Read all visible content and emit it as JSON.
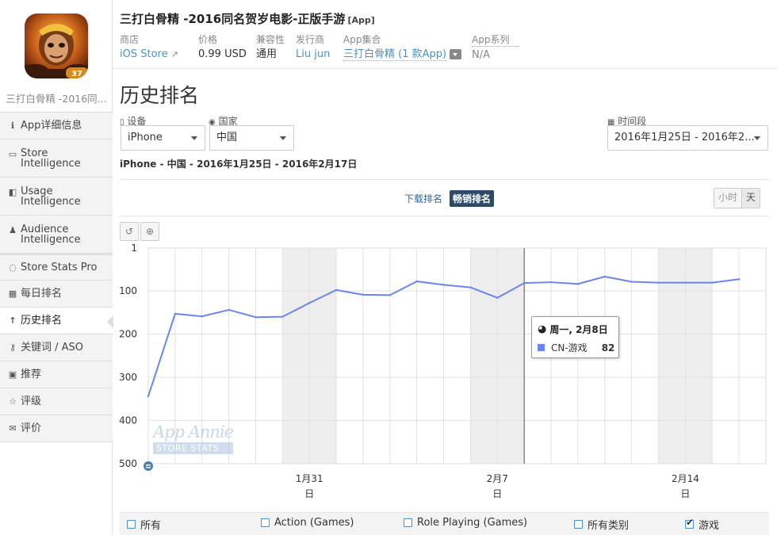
{
  "sidebar": {
    "app_short_name": "三打白骨精 -2016同...",
    "icon_badge": "37",
    "items": [
      {
        "icon": "info-icon",
        "glyph": "ℹ",
        "label": "App详细信息"
      },
      {
        "icon": "store-icon",
        "glyph": "▭",
        "label": "Store Intelligence"
      },
      {
        "icon": "usage-icon",
        "glyph": "◧",
        "label": "Usage Intelligence"
      },
      {
        "icon": "person-icon",
        "glyph": "♟",
        "label": "Audience Intelligence"
      },
      {
        "icon": "gauge-icon",
        "glyph": "◌",
        "label": "Store Stats Pro"
      },
      {
        "icon": "calendar-icon",
        "glyph": "▦",
        "label": "每日排名"
      },
      {
        "icon": "arrow-up-icon",
        "glyph": "↑",
        "label": "历史排名"
      },
      {
        "icon": "key-icon",
        "glyph": "⚷",
        "label": "关键词 / ASO"
      },
      {
        "icon": "bookmark-icon",
        "glyph": "▣",
        "label": "推荐"
      },
      {
        "icon": "star-icon",
        "glyph": "☆",
        "label": "评级"
      },
      {
        "icon": "comments-icon",
        "glyph": "✉",
        "label": "评价"
      }
    ]
  },
  "header": {
    "title": "三打白骨精 -2016同名贺岁电影-正版手游",
    "tag": "[App]",
    "meta": [
      {
        "label": "商店",
        "value": "iOS Store"
      },
      {
        "label": "价格",
        "value": "0.99 USD"
      },
      {
        "label": "兼容性",
        "value": "通用"
      },
      {
        "label": "发行商",
        "value": "Liu jun"
      },
      {
        "label": "App集合",
        "value": "三打白骨精 (1 款App)"
      },
      {
        "label": "App系列",
        "value": "N/A"
      }
    ]
  },
  "page_title": "历史排名",
  "filters": {
    "device_label": "设备",
    "device_value": "iPhone",
    "country_label": "国家",
    "country_value": "中国",
    "period_label": "时间段",
    "period_value": "2016年1月25日 - 2016年2..."
  },
  "subtitle": {
    "device": "iPhone",
    "country": "中国",
    "start": "2016年1月25日",
    "end": "2016年2月17日"
  },
  "metric_tabs": [
    "下载排名",
    "畅销排名"
  ],
  "granularity": [
    "小时",
    "天"
  ],
  "tooltip": {
    "title": "周一, 2月8日",
    "series": "CN-游戏",
    "value": "82"
  },
  "watermark": {
    "brand": "App Annie",
    "sub": "STORE STATS"
  },
  "legend": [
    {
      "label": "所有",
      "checked": false
    },
    {
      "label": "Action (Games)",
      "checked": false
    },
    {
      "label": "Role Playing (Games)",
      "checked": false
    },
    {
      "label": "所有类别",
      "checked": false
    },
    {
      "label": "游戏",
      "checked": true
    }
  ],
  "colors": {
    "line": "#6a86ee",
    "weekend": "#eeeeee",
    "accent": "#2e4a66",
    "link": "#4a90c8"
  },
  "chart_data": {
    "type": "line",
    "title": "",
    "xlabel": "",
    "ylabel": "",
    "y_reversed": true,
    "ylim": [
      1,
      500
    ],
    "yticks": [
      1,
      100,
      200,
      300,
      400,
      500
    ],
    "x": [
      "2016-01-25",
      "2016-01-26",
      "2016-01-27",
      "2016-01-28",
      "2016-01-29",
      "2016-01-30",
      "2016-01-31",
      "2016-02-01",
      "2016-02-02",
      "2016-02-03",
      "2016-02-04",
      "2016-02-05",
      "2016-02-06",
      "2016-02-07",
      "2016-02-08",
      "2016-02-09",
      "2016-02-10",
      "2016-02-11",
      "2016-02-12",
      "2016-02-13",
      "2016-02-14",
      "2016-02-15",
      "2016-02-16"
    ],
    "x_range": [
      "2016-01-25",
      "2016-02-17"
    ],
    "xticks": [
      {
        "date": "2016-01-31",
        "label": "1月31",
        "sub": "日"
      },
      {
        "date": "2016-02-07",
        "label": "2月7",
        "sub": "日"
      },
      {
        "date": "2016-02-14",
        "label": "2月14",
        "sub": "日"
      }
    ],
    "weekend_bands": [
      [
        "2016-01-30",
        "2016-02-01"
      ],
      [
        "2016-02-06",
        "2016-02-08"
      ],
      [
        "2016-02-13",
        "2016-02-15"
      ]
    ],
    "crosshair_date": "2016-02-08",
    "series": [
      {
        "name": "CN-游戏",
        "values": [
          344,
          153,
          159,
          144,
          161,
          160,
          128,
          98,
          109,
          110,
          78,
          86,
          92,
          116,
          82,
          80,
          84,
          67,
          79,
          81,
          81,
          81,
          73
        ]
      }
    ]
  }
}
